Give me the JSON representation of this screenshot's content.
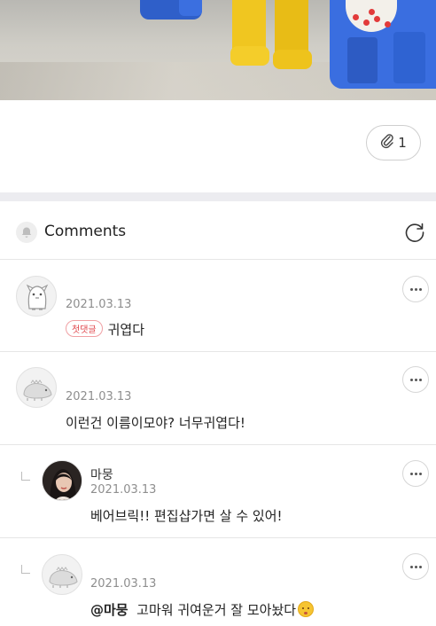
{
  "attachment": {
    "count": "1",
    "icon": "paperclip-icon"
  },
  "comments_header": {
    "title": "Comments",
    "icons": [
      "bell-icon",
      "refresh-icon"
    ]
  },
  "comments": [
    {
      "date": "2021.03.13",
      "badge": "첫댓글",
      "text": "귀엽다",
      "avatar": "penguin-avatar",
      "is_reply": false
    },
    {
      "date": "2021.03.13",
      "text": "이런건 이름이모야? 너무귀엽다!",
      "avatar": "dino-avatar",
      "is_reply": false
    },
    {
      "author": "마뭉",
      "date": "2021.03.13",
      "text": "베어브릭!! 편집샵가면 살 수 있어!",
      "avatar": "photo-avatar",
      "is_reply": true
    },
    {
      "date": "2021.03.13",
      "mention": "@마뭉",
      "text": "고마워 귀여운거 잘 모아놨다",
      "emoji": "shushing-face-emoji",
      "avatar": "dino-avatar",
      "is_reply": true
    }
  ],
  "colors": {
    "badge": "#e0464b",
    "divider": "#ececf0",
    "date": "#8e8e8e"
  }
}
